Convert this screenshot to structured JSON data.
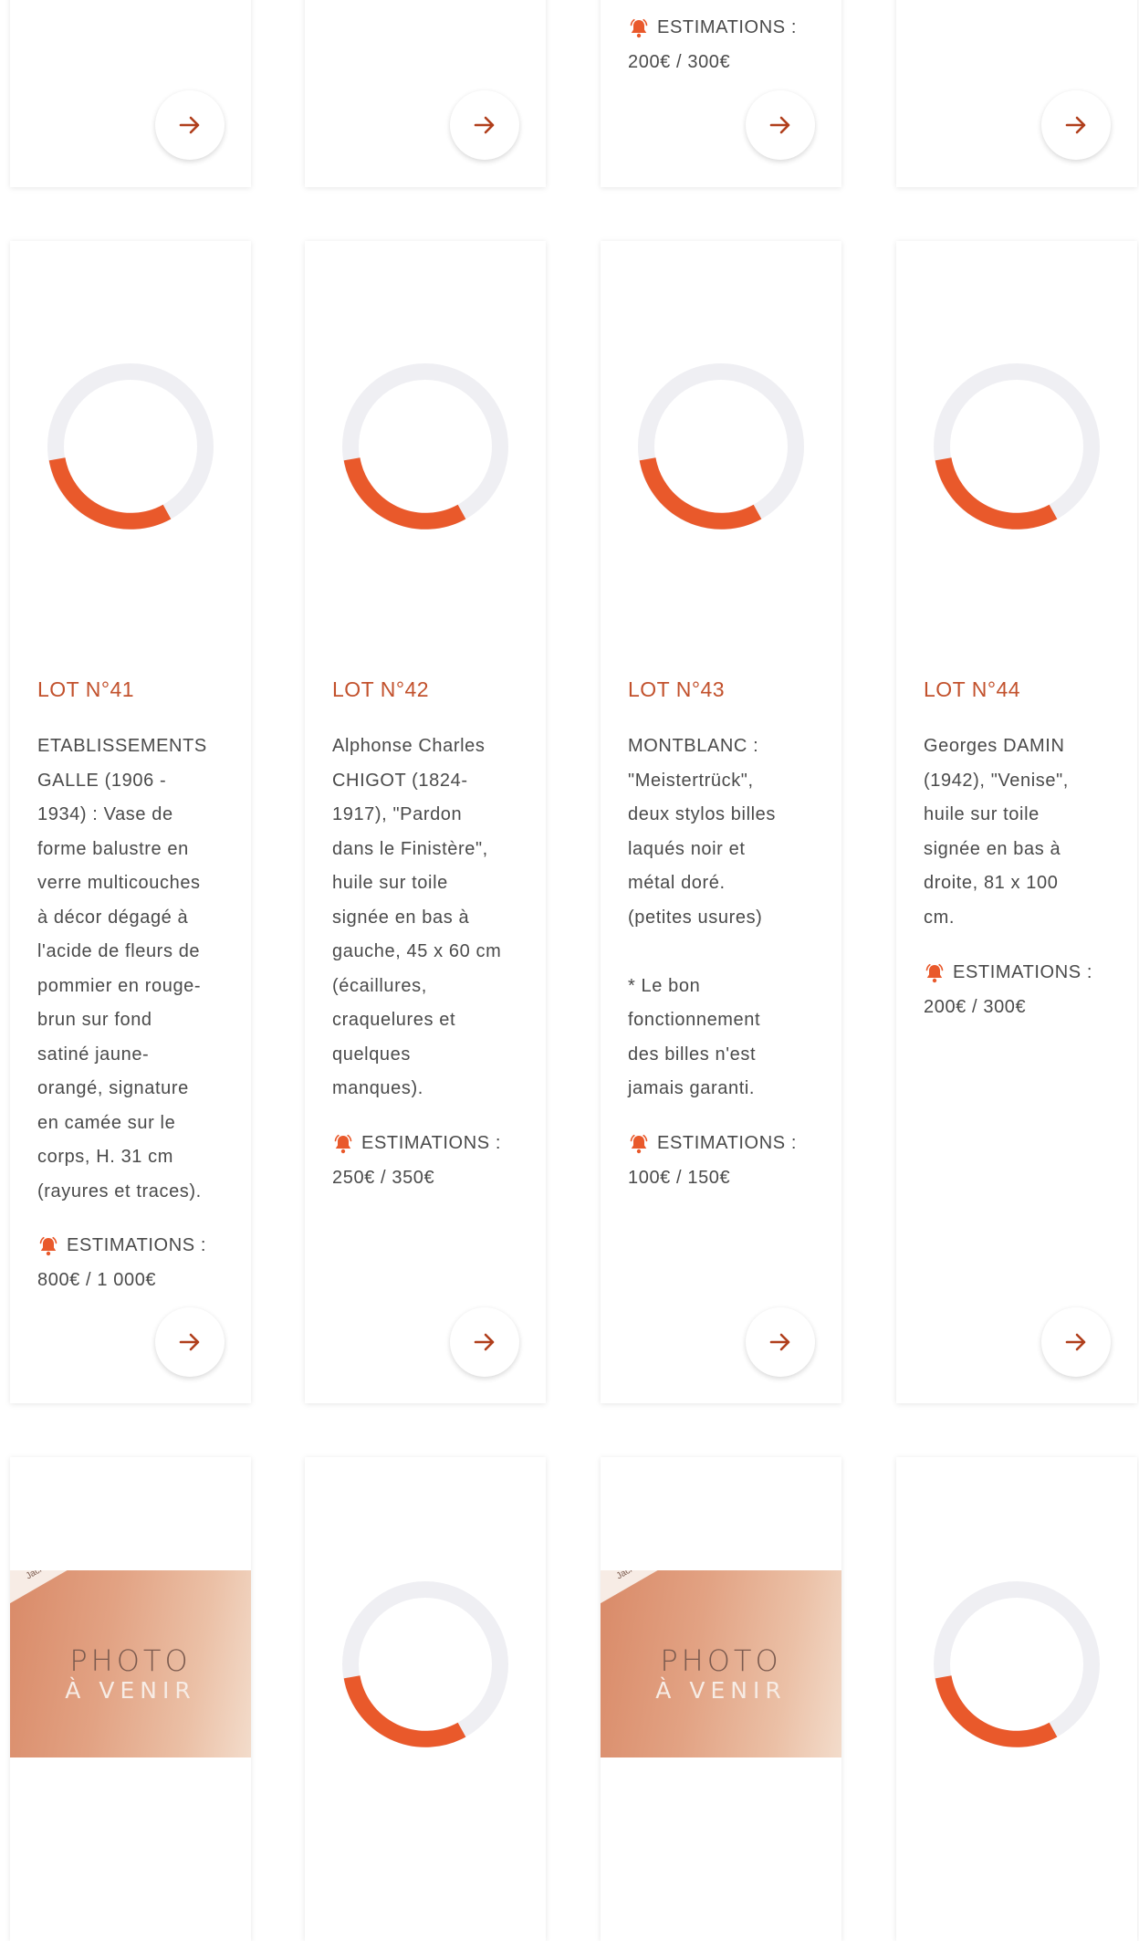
{
  "colors": {
    "accent": "#e9592b",
    "lot_title": "#c2512c",
    "arrow": "#b03e1b",
    "spinner_track": "#efeff3"
  },
  "icons": {
    "arrow": "arrow-right-icon",
    "bell": "bell-icon",
    "loader": "spinner-icon"
  },
  "top_row": {
    "lot3_estimate": {
      "label": "ESTIMATIONS :",
      "value": "200€ / 300€"
    }
  },
  "lots": [
    {
      "title": "LOT N°41",
      "description": "ETABLISSEMENTS\nGALLE (1906 -\n1934) : Vase de\nforme balustre en\nverre multicouches\nà décor dégagé à\nl'acide de fleurs de\npommier en rouge-\nbrun sur fond\nsatiné jaune-\norangé, signature\nen camée sur le\ncorps, H. 31 cm\n(rayures et traces).",
      "estimate_label": "ESTIMATIONS :",
      "estimate_value": "800€ / 1 000€"
    },
    {
      "title": "LOT N°42",
      "description": "Alphonse Charles\nCHIGOT (1824-\n1917), \"Pardon\ndans le Finistère\",\nhuile sur toile\nsignée en bas à\ngauche, 45 x 60 cm\n(écaillures,\ncraquelures et\nquelques\nmanques).",
      "estimate_label": "ESTIMATIONS :",
      "estimate_value": "250€ / 350€"
    },
    {
      "title": "LOT N°43",
      "description": "MONTBLANC :\n\"Meistertrück\",\ndeux stylos billes\nlaqués noir et\nmétal doré.\n(petites usures)\n\n* Le bon\nfonctionnement\ndes billes n'est\njamais garanti.",
      "estimate_label": "ESTIMATIONS :",
      "estimate_value": "100€ / 150€"
    },
    {
      "title": "LOT N°44",
      "description": "Georges DAMIN\n(1942), \"Venise\",\nhuile sur toile\nsignée en bas à\ndroite, 81 x 100\ncm.",
      "estimate_label": "ESTIMATIONS :",
      "estimate_value": "200€ / 300€"
    }
  ],
  "photo_placeholder": {
    "line1": "PHOTO",
    "line2": "À VENIR",
    "watermark": "Jack-Philippe RUELLAN"
  }
}
